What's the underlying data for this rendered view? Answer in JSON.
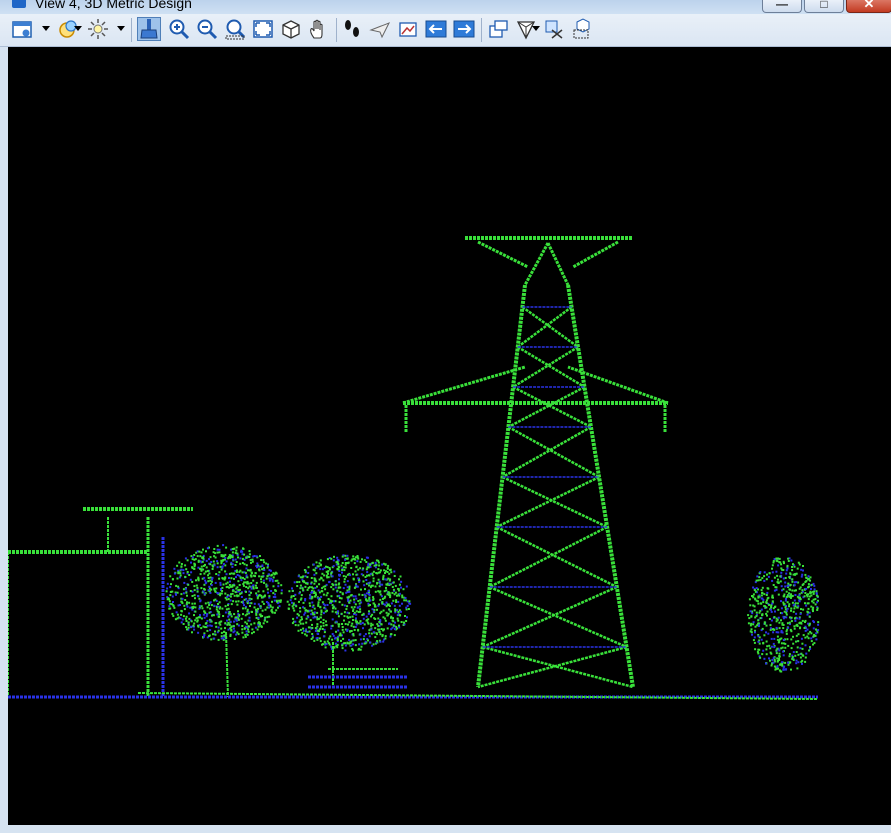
{
  "window": {
    "title": "View 4, 3D Metric Design",
    "controls": {
      "minimize": "—",
      "maximize": "□",
      "close": "✕"
    }
  },
  "toolbar": {
    "icons": [
      "view-attributes-icon",
      "view-display-mode-icon",
      "lighting-icon",
      "update-view-icon",
      "zoom-in-icon",
      "zoom-out-icon",
      "window-area-icon",
      "fit-view-icon",
      "rotate-view-icon",
      "pan-view-icon",
      "walk-icon",
      "fly-icon",
      "view-camera-icon",
      "view-previous-icon",
      "view-next-icon",
      "copy-view-icon",
      "clip-volume-icon",
      "clip-mask-icon",
      "display-set-icon"
    ],
    "active_tool": "update-view-icon"
  },
  "scene": {
    "background": "#000000",
    "point_colors": {
      "green": "#39e03a",
      "blue": "#2a32e6"
    }
  }
}
